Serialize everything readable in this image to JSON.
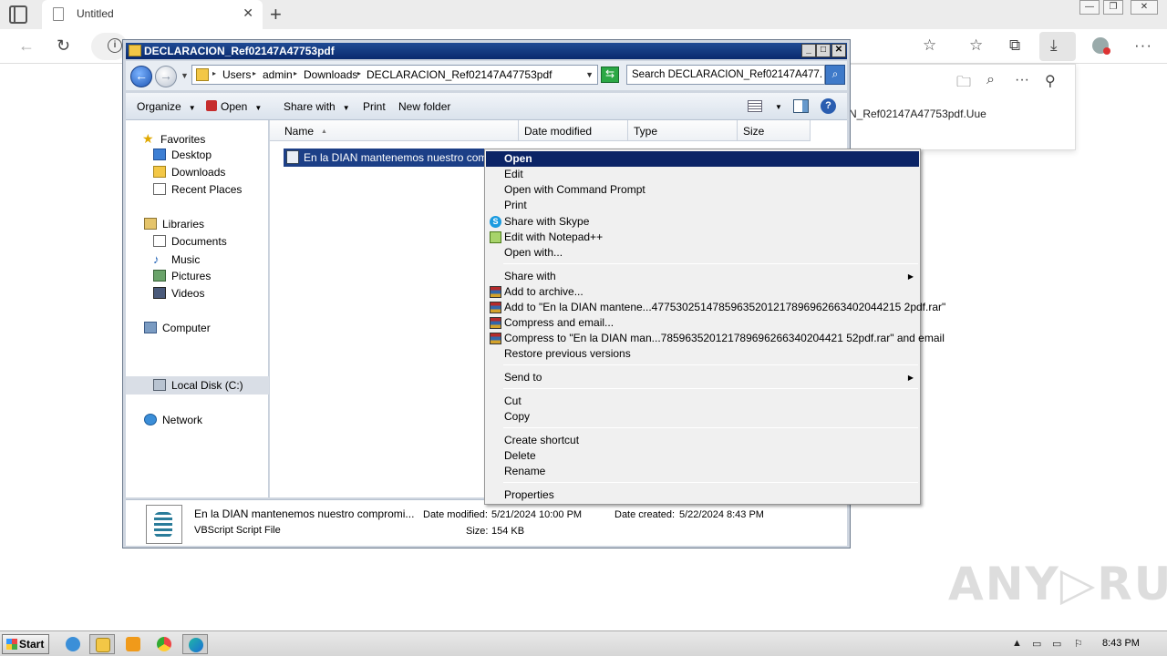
{
  "browser": {
    "tab_title": "Untitled",
    "tab_close": "✕",
    "new_tab": "+",
    "download_filename": "N_Ref02147A47753pdf.Uue"
  },
  "explorer": {
    "title": "DECLARACION_Ref02147A47753pdf",
    "breadcrumb": [
      "Users",
      "admin",
      "Downloads",
      "DECLARACION_Ref02147A47753pdf"
    ],
    "search_placeholder": "Search DECLARACION_Ref02147A477...",
    "commands": {
      "organize": "Organize",
      "open": "Open",
      "share_with": "Share with",
      "print": "Print",
      "new_folder": "New folder"
    },
    "nav": {
      "favorites": "Favorites",
      "desktop": "Desktop",
      "downloads": "Downloads",
      "recent_places": "Recent Places",
      "libraries": "Libraries",
      "documents": "Documents",
      "music": "Music",
      "pictures": "Pictures",
      "videos": "Videos",
      "computer": "Computer",
      "local_disk": "Local Disk (C:)",
      "network": "Network"
    },
    "columns": [
      "Name",
      "Date modified",
      "Type",
      "Size"
    ],
    "selected_file": "En la DIAN mantenemos nuestro compromi",
    "details": {
      "name": "En la DIAN mantenemos nuestro compromi...",
      "type": "VBScript Script File",
      "date_modified_label": "Date modified:",
      "date_modified": "5/21/2024 10:00 PM",
      "date_created_label": "Date created:",
      "date_created": "5/22/2024 8:43 PM",
      "size_label": "Size:",
      "size": "154 KB"
    }
  },
  "context_menu": {
    "open": "Open",
    "edit": "Edit",
    "open_cmd": "Open with Command Prompt",
    "print": "Print",
    "share_skype": "Share with Skype",
    "edit_npp": "Edit with Notepad++",
    "open_with": "Open with...",
    "share_with": "Share with",
    "add_archive": "Add to archive...",
    "add_to_rar": "Add to \"En la DIAN mantene...47753025147859635201217896962663402044215 2pdf.rar\"",
    "compress_email": "Compress and email...",
    "compress_to_rar_email": "Compress to \"En la DIAN man...785963520121789696266340204421 52pdf.rar\" and email",
    "restore": "Restore previous versions",
    "send_to": "Send to",
    "cut": "Cut",
    "copy": "Copy",
    "create_shortcut": "Create shortcut",
    "delete": "Delete",
    "rename": "Rename",
    "properties": "Properties"
  },
  "taskbar": {
    "start": "Start",
    "clock": "8:43 PM"
  },
  "watermark": "ANY▷RUN"
}
